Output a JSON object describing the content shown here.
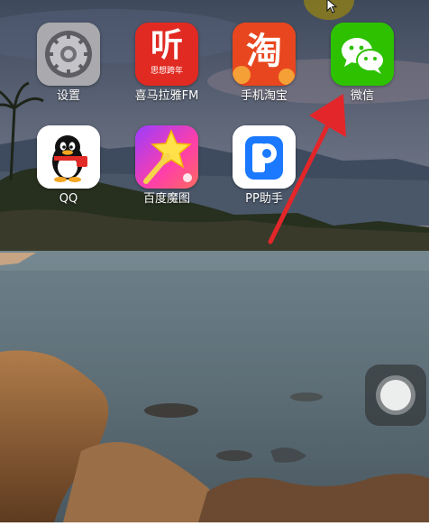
{
  "apps": [
    {
      "id": "settings",
      "label": "设置"
    },
    {
      "id": "ximalaya",
      "label": "喜马拉雅FM",
      "icon_text": "听",
      "icon_subtext": "思想跨年"
    },
    {
      "id": "taobao",
      "label": "手机淘宝",
      "icon_text": "淘"
    },
    {
      "id": "wechat",
      "label": "微信"
    },
    {
      "id": "qq",
      "label": "QQ"
    },
    {
      "id": "baidu-magic",
      "label": "百度魔图"
    },
    {
      "id": "pp",
      "label": "PP助手",
      "icon_text": "P"
    }
  ],
  "colors": {
    "ximalaya": "#e02a22",
    "taobao": "#e8461e",
    "wechat": "#2dc100",
    "pp": "#1a79ff",
    "annotation_arrow": "#e3262a"
  },
  "icons": {
    "settings": "gear-icon",
    "wechat": "chat-bubbles-icon",
    "qq": "penguin-icon",
    "baidu-magic": "magic-wand-star-icon",
    "assistive_touch": "assistive-touch-icon",
    "cursor": "mouse-pointer-icon"
  }
}
